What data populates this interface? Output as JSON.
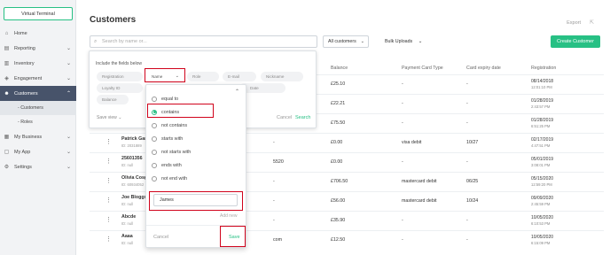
{
  "sidebar": {
    "virtual_terminal": "Virtual Terminal",
    "items": [
      {
        "label": "Home",
        "icon": "home-icon",
        "chevron": false
      },
      {
        "label": "Reporting",
        "icon": "report-icon",
        "chevron": true
      },
      {
        "label": "Inventory",
        "icon": "box-icon",
        "chevron": true
      },
      {
        "label": "Engagement",
        "icon": "engagement-icon",
        "chevron": true
      },
      {
        "label": "Customers",
        "icon": "users-icon",
        "chevron": true,
        "active": true
      },
      {
        "label": "My Business",
        "icon": "business-icon",
        "chevron": true
      },
      {
        "label": "My App",
        "icon": "app-icon",
        "chevron": true
      },
      {
        "label": "Settings",
        "icon": "gear-icon",
        "chevron": true
      }
    ],
    "sub_items": [
      "- Customers",
      "- Roles"
    ]
  },
  "header": {
    "title": "Customers",
    "export": "Export",
    "search_placeholder": "Search by name or...",
    "all_customers": "All customers",
    "bulk_uploads": "Bulk Uploads",
    "create_customer": "Create Customer"
  },
  "table": {
    "columns": [
      "Balance",
      "Payment Card Type",
      "Card expiry date",
      "Registration"
    ],
    "rows": [
      {
        "name": "",
        "id": "",
        "mid": "",
        "balance": "£25.10",
        "card": "-",
        "expiry": "-",
        "reg_date": "08/14/2018",
        "reg_time": "12:01:10 PM"
      },
      {
        "name": "",
        "id": "",
        "mid": "",
        "balance": "£22.21",
        "card": "-",
        "expiry": "-",
        "reg_date": "01/28/2019",
        "reg_time": "2:43:57 PM"
      },
      {
        "name": "",
        "id": "",
        "mid": "",
        "balance": "£75.50",
        "card": "-",
        "expiry": "-",
        "reg_date": "01/28/2019",
        "reg_time": "6:51:25 PM"
      },
      {
        "name": "Patrick Gar",
        "id": "ID: 2031889",
        "mid": "-",
        "balance": "£0.00",
        "card": "visa debit",
        "expiry": "10/27",
        "reg_date": "02/17/2019",
        "reg_time": "4:47:51 PM"
      },
      {
        "name": "25601356",
        "id": "ID: null",
        "mid": "5520",
        "balance": "£0.00",
        "card": "-",
        "expiry": "-",
        "reg_date": "05/01/2019",
        "reg_time": "3:08:01 PM"
      },
      {
        "name": "Olivia Cosg",
        "id": "ID: 60934052",
        "mid": "-",
        "balance": "£706.50",
        "card": "mastercard debit",
        "expiry": "06/25",
        "reg_date": "05/15/2020",
        "reg_time": "12:59:20 PM"
      },
      {
        "name": "Joe Bloggs",
        "id": "ID: null",
        "mid": "-",
        "balance": "£56.00",
        "card": "mastercard debit",
        "expiry": "10/24",
        "reg_date": "09/09/2020",
        "reg_time": "2:45:59 PM"
      },
      {
        "name": "Abcde",
        "id": "ID: null",
        "mid": "-",
        "balance": "£35.90",
        "card": "-",
        "expiry": "-",
        "reg_date": "10/05/2020",
        "reg_time": "6:10:53 PM"
      },
      {
        "name": "Aaaa",
        "id": "ID: null",
        "mid": "com",
        "balance": "£12.50",
        "card": "-",
        "expiry": "-",
        "reg_date": "10/05/2020",
        "reg_time": "6:15:09 PM"
      }
    ]
  },
  "filter": {
    "title": "Include the fields below",
    "chips": [
      "Registration",
      "Name",
      "Role",
      "E-mail",
      "Nickname",
      "Loyalty ID",
      "Date",
      "Balance"
    ],
    "save_view": "Save view",
    "cancel": "Cancel",
    "search": "Search"
  },
  "popup": {
    "options": [
      "equal to",
      "contains",
      "not contains",
      "starts with",
      "not starts with",
      "ends with",
      "not end with"
    ],
    "selected": "contains",
    "value": "James",
    "add_new": "Add new",
    "cancel": "Cancel",
    "save": "Save"
  },
  "colors": {
    "accent": "#27c084",
    "highlight": "#d0021b",
    "sidebar_active": "#47536a"
  }
}
